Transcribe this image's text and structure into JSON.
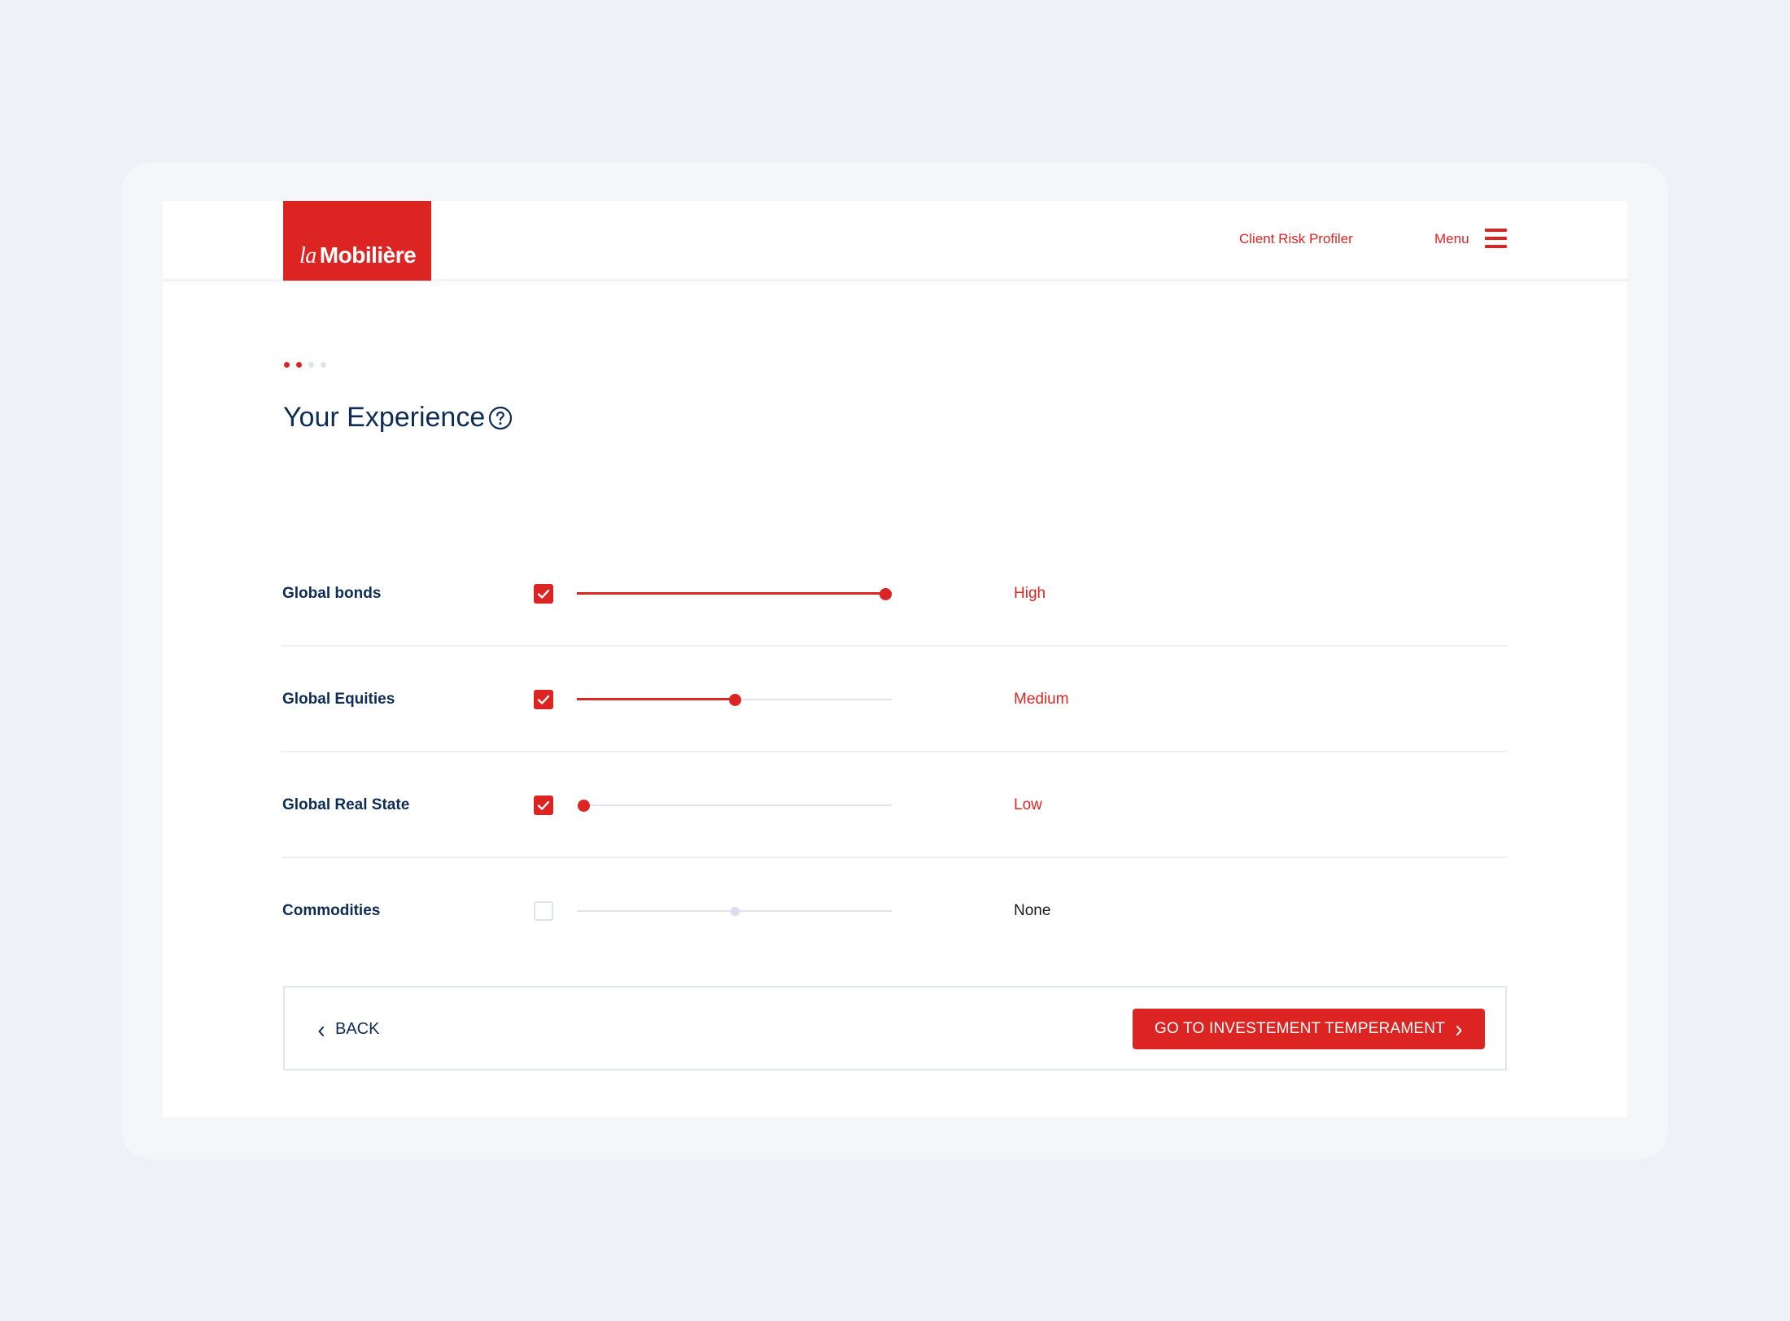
{
  "header": {
    "logo_prefix": "la",
    "logo_name": "Mobilière",
    "nav_client_risk": "Client Risk Profiler",
    "nav_menu": "Menu"
  },
  "steps": {
    "total": 4,
    "active": 2,
    "colors": {
      "active": "#dc2522",
      "inactive": "#dde3ec"
    }
  },
  "page": {
    "title": "Your Experience"
  },
  "experience": [
    {
      "label": "Global bonds",
      "checked": true,
      "level": 1.0,
      "value_label": "High",
      "enabled": true
    },
    {
      "label": "Global Equities",
      "checked": true,
      "level": 0.5,
      "value_label": "Medium",
      "enabled": true
    },
    {
      "label": "Global Real State",
      "checked": true,
      "level": 0.0,
      "value_label": "Low",
      "enabled": true
    },
    {
      "label": "Commodities",
      "checked": false,
      "level": 0.5,
      "value_label": "None",
      "enabled": false
    }
  ],
  "footer": {
    "back_label": "BACK",
    "next_label": "GO TO INVESTEMENT TEMPERAMENT"
  },
  "colors": {
    "brand_red": "#dc2522",
    "navy": "#0e2d55",
    "value_active": "#dc2522",
    "value_inactive": "#1a1a1a"
  }
}
